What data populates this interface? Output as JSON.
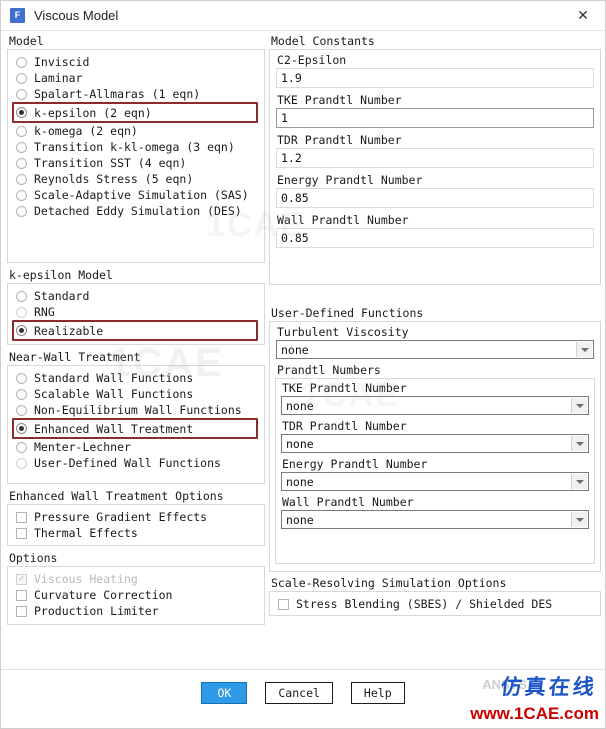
{
  "window": {
    "title": "Viscous Model",
    "icon_glyph": "F",
    "close_glyph": "✕"
  },
  "model": {
    "group_label": "Model",
    "options": [
      {
        "label": "Inviscid",
        "selected": false
      },
      {
        "label": "Laminar",
        "selected": false
      },
      {
        "label": "Spalart-Allmaras (1 eqn)",
        "selected": false
      },
      {
        "label": "k-epsilon (2 eqn)",
        "selected": true
      },
      {
        "label": "k-omega (2 eqn)",
        "selected": false
      },
      {
        "label": "Transition k-kl-omega (3 eqn)",
        "selected": false
      },
      {
        "label": "Transition SST (4 eqn)",
        "selected": false
      },
      {
        "label": "Reynolds Stress (5 eqn)",
        "selected": false
      },
      {
        "label": "Scale-Adaptive Simulation (SAS)",
        "selected": false
      },
      {
        "label": "Detached Eddy Simulation (DES)",
        "selected": false
      }
    ]
  },
  "kepsilon_model": {
    "group_label": "k-epsilon Model",
    "options": [
      {
        "label": "Standard",
        "selected": false
      },
      {
        "label": "RNG",
        "selected": false
      },
      {
        "label": "Realizable",
        "selected": true
      }
    ]
  },
  "near_wall": {
    "group_label": "Near-Wall Treatment",
    "options": [
      {
        "label": "Standard Wall Functions",
        "selected": false
      },
      {
        "label": "Scalable Wall Functions",
        "selected": false
      },
      {
        "label": "Non-Equilibrium Wall Functions",
        "selected": false
      },
      {
        "label": "Enhanced Wall Treatment",
        "selected": true
      },
      {
        "label": "Menter-Lechner",
        "selected": false
      },
      {
        "label": "User-Defined Wall Functions",
        "selected": false
      }
    ]
  },
  "ewt_options": {
    "group_label": "Enhanced Wall Treatment Options",
    "items": [
      {
        "label": "Pressure Gradient Effects",
        "checked": false,
        "disabled": false
      },
      {
        "label": "Thermal Effects",
        "checked": false,
        "disabled": false
      }
    ]
  },
  "options": {
    "group_label": "Options",
    "items": [
      {
        "label": "Viscous Heating",
        "checked": true,
        "disabled": true
      },
      {
        "label": "Curvature Correction",
        "checked": false,
        "disabled": false
      },
      {
        "label": "Production Limiter",
        "checked": false,
        "disabled": false
      }
    ]
  },
  "model_constants": {
    "group_label": "Model Constants",
    "fields": [
      {
        "label": "C2-Epsilon",
        "value": "1.9",
        "focused": false
      },
      {
        "label": "TKE Prandtl Number",
        "value": "1",
        "focused": true
      },
      {
        "label": "TDR Prandtl Number",
        "value": "1.2",
        "focused": false
      },
      {
        "label": "Energy Prandtl Number",
        "value": "0.85",
        "focused": false
      },
      {
        "label": "Wall Prandtl Number",
        "value": "0.85",
        "focused": false
      }
    ]
  },
  "udf": {
    "group_label": "User-Defined Functions",
    "turbulent_viscosity": {
      "label": "Turbulent Viscosity",
      "value": "none"
    },
    "prandtl_numbers": {
      "group_label": "Prandtl Numbers",
      "fields": [
        {
          "label": "TKE Prandtl Number",
          "value": "none"
        },
        {
          "label": "TDR Prandtl Number",
          "value": "none"
        },
        {
          "label": "Energy Prandtl Number",
          "value": "none"
        },
        {
          "label": "Wall Prandtl Number",
          "value": "none"
        }
      ]
    }
  },
  "srs": {
    "group_label": "Scale-Resolving Simulation Options",
    "items": [
      {
        "label": "Stress Blending (SBES) / Shielded DES",
        "checked": false,
        "disabled": false
      }
    ]
  },
  "footer": {
    "buttons": [
      {
        "label": "OK",
        "primary": true
      },
      {
        "label": "Cancel",
        "primary": false
      },
      {
        "label": "Help",
        "primary": false
      }
    ]
  },
  "watermarks": {
    "logo_cn": "仿真在线",
    "url": "www.1CAE.com",
    "faint": "1CAE",
    "ansys": "ANSYS"
  },
  "colors": {
    "accent": "#2e9ae8",
    "highlight_border": "#8c2b2b",
    "watermark_red": "#cc0000",
    "watermark_blue": "#1a54c8"
  }
}
